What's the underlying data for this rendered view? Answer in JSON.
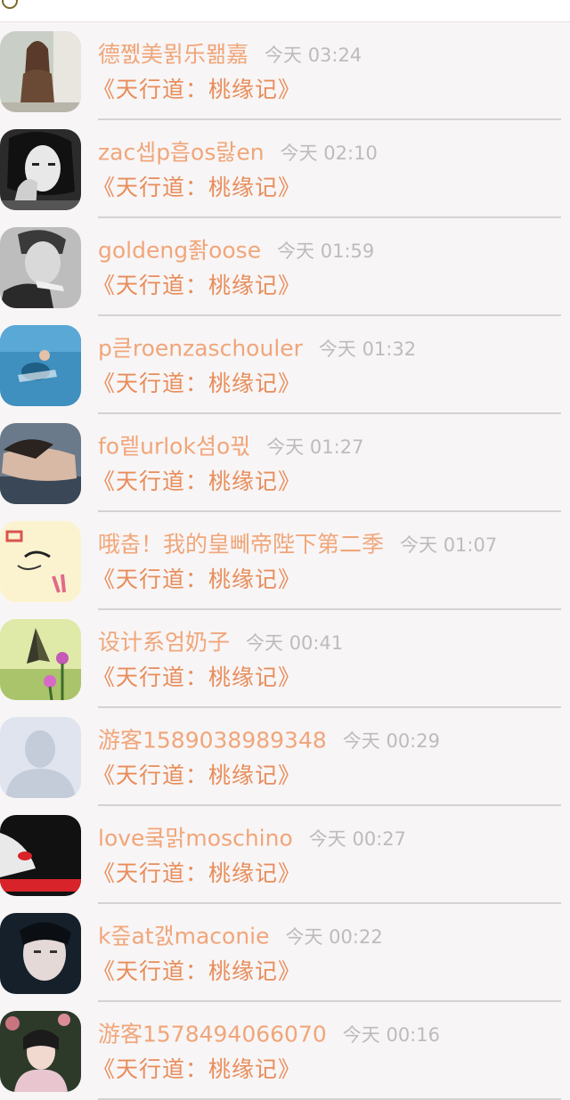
{
  "comments": [
    {
      "nickname": "德쪬美뮑乐뫪嘉",
      "time": "今天 03:24",
      "book": "《天行道：桃缘记》",
      "avatar_icon": "woman-avatar-icon",
      "avatar_colors": [
        "#c9cfc6",
        "#6b4a35"
      ]
    },
    {
      "nickname": "zac셉p흡os랋en",
      "time": "今天 02:10",
      "book": "《天行道：桃缘记》",
      "avatar_icon": "bw-woman-avatar-icon",
      "avatar_colors": [
        "#2b2b2b",
        "#e8e8e8"
      ]
    },
    {
      "nickname": "goldeng좕oose",
      "time": "今天 01:59",
      "book": "《天行道：桃缘记》",
      "avatar_icon": "bw-man-avatar-icon",
      "avatar_colors": [
        "#3a3a3a",
        "#d9d9d9"
      ]
    },
    {
      "nickname": "p큳roenzaschouler",
      "time": "今天 01:32",
      "book": "《天行道：桃缘记》",
      "avatar_icon": "pool-avatar-icon",
      "avatar_colors": [
        "#3f8fbf",
        "#1e5f86"
      ]
    },
    {
      "nickname": "fo렡urlok셤o끣",
      "time": "今天 01:27",
      "book": "《天行道：桃缘记》",
      "avatar_icon": "girl-lying-avatar-icon",
      "avatar_colors": [
        "#4b5a6b",
        "#d8b9a6"
      ]
    },
    {
      "nickname": "哦춥！我的皇뻬帝陛下第二季",
      "time": "今天 01:07",
      "book": "《天行道：桃缘记》",
      "avatar_icon": "cartoon-avatar-icon",
      "avatar_colors": [
        "#fbf3cf",
        "#d9534f"
      ]
    },
    {
      "nickname": "设计系엄奶子",
      "time": "今天 00:41",
      "book": "《天行道：桃缘记》",
      "avatar_icon": "butterfly-avatar-icon",
      "avatar_colors": [
        "#dfe9a8",
        "#3a3a2a"
      ]
    },
    {
      "nickname": "游客1589038989348",
      "time": "今天 00:29",
      "book": "《天行道：桃缘记》",
      "avatar_icon": "default-user-avatar-icon",
      "avatar_colors": [
        "#dfe4ee",
        "#c4cbd9"
      ]
    },
    {
      "nickname": "love쿸맑moschino",
      "time": "今天 00:27",
      "book": "《天行道：桃缘记》",
      "avatar_icon": "red-lips-avatar-icon",
      "avatar_colors": [
        "#111111",
        "#d8232a"
      ]
    },
    {
      "nickname": "k즢at갨maconie",
      "time": "今天 00:22",
      "book": "《天行道：桃缘记》",
      "avatar_icon": "face-avatar-icon",
      "avatar_colors": [
        "#15202b",
        "#e4d9d6"
      ]
    },
    {
      "nickname": "游客1578494066070",
      "time": "今天 00:16",
      "book": "《天行道：桃缘记》",
      "avatar_icon": "flower-girl-avatar-icon",
      "avatar_colors": [
        "#c8757f",
        "#2d3a2a"
      ]
    }
  ],
  "colors": {
    "nickname": "#f0a67a",
    "book": "#e88d5a",
    "time": "#bcbcbc",
    "background": "#f8f5f6"
  }
}
